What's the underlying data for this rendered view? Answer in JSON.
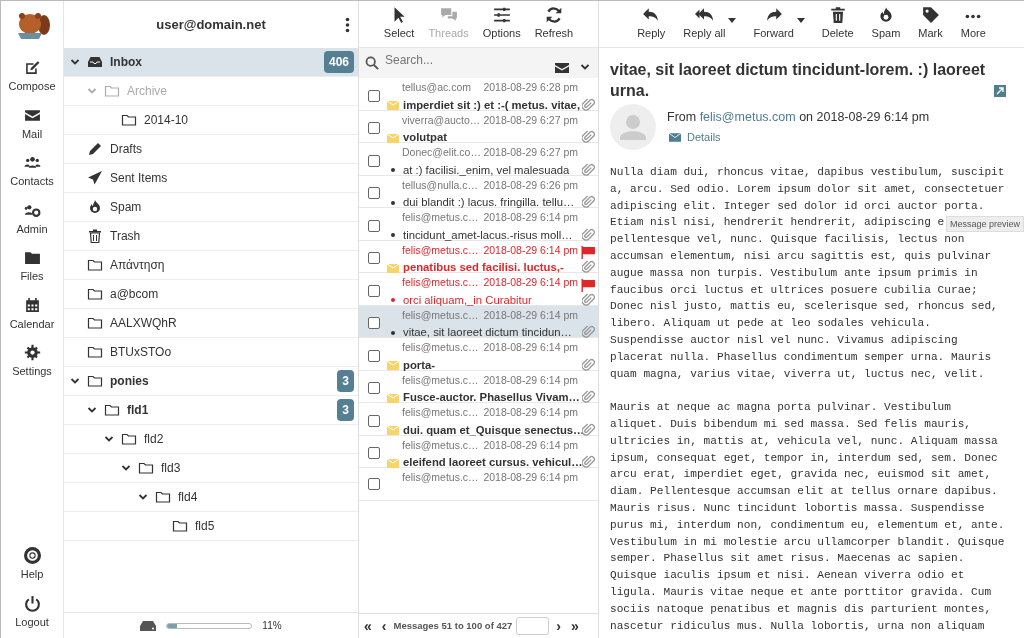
{
  "nav": {
    "items": [
      {
        "kind": "compose",
        "label": "Compose"
      },
      {
        "kind": "mail",
        "label": "Mail"
      },
      {
        "kind": "contacts",
        "label": "Contacts"
      },
      {
        "kind": "admin",
        "label": "Admin"
      },
      {
        "kind": "files",
        "label": "Files"
      },
      {
        "kind": "calendar",
        "label": "Calendar"
      },
      {
        "kind": "settings",
        "label": "Settings"
      }
    ],
    "bottom": [
      {
        "kind": "help",
        "label": "Help"
      },
      {
        "kind": "logout",
        "label": "Logout"
      }
    ]
  },
  "folders": {
    "account": "user@domain.net",
    "items": [
      {
        "kind": "inbox",
        "name": "Inbox",
        "count": "406",
        "selected": true,
        "bold": true,
        "expanded": true,
        "disabled": false,
        "children": [
          {
            "kind": "folder",
            "name": "Archive",
            "selected": false,
            "bold": false,
            "expanded": true,
            "disabled": true,
            "children": [
              {
                "kind": "folder",
                "name": "2014-10",
                "selected": false,
                "bold": false,
                "disabled": false
              }
            ]
          }
        ]
      },
      {
        "kind": "drafts",
        "name": "Drafts",
        "selected": false,
        "bold": false,
        "disabled": false
      },
      {
        "kind": "sent",
        "name": "Sent Items",
        "selected": false,
        "bold": false,
        "disabled": false
      },
      {
        "kind": "spam",
        "name": "Spam",
        "selected": false,
        "bold": false,
        "disabled": false
      },
      {
        "kind": "trash",
        "name": "Trash",
        "selected": false,
        "bold": false,
        "disabled": false
      },
      {
        "kind": "folder",
        "name": "Απάντηση",
        "selected": false,
        "bold": false,
        "disabled": false
      },
      {
        "kind": "folder",
        "name": "a@bcom",
        "selected": false,
        "bold": false,
        "disabled": false
      },
      {
        "kind": "folder",
        "name": "AALXWQhR",
        "selected": false,
        "bold": false,
        "disabled": false
      },
      {
        "kind": "folder",
        "name": "BTUxSTOo",
        "selected": false,
        "bold": false,
        "disabled": false
      },
      {
        "kind": "folder",
        "name": "ponies",
        "count": "3",
        "selected": false,
        "bold": true,
        "expanded": true,
        "disabled": false,
        "children": [
          {
            "kind": "folder",
            "name": "fld1",
            "count": "3",
            "selected": false,
            "bold": true,
            "expanded": true,
            "disabled": false,
            "children": [
              {
                "kind": "folder",
                "name": "fld2",
                "selected": false,
                "bold": false,
                "expanded": true,
                "disabled": false,
                "children": [
                  {
                    "kind": "folder",
                    "name": "fld3",
                    "selected": false,
                    "bold": false,
                    "expanded": true,
                    "disabled": false,
                    "children": [
                      {
                        "kind": "folder",
                        "name": "fld4",
                        "selected": false,
                        "bold": false,
                        "expanded": true,
                        "disabled": false,
                        "children": [
                          {
                            "kind": "folder",
                            "name": "fld5",
                            "selected": false,
                            "bold": false,
                            "disabled": false
                          }
                        ]
                      }
                    ]
                  }
                ]
              }
            ]
          }
        ]
      }
    ],
    "quota": {
      "level": 0.11,
      "text": "11%"
    }
  },
  "list_toolbar": [
    {
      "kind": "select",
      "label": "Select",
      "disabled": false
    },
    {
      "kind": "threads",
      "label": "Threads",
      "disabled": true
    },
    {
      "kind": "options",
      "label": "Options",
      "disabled": false
    },
    {
      "kind": "refresh",
      "label": "Refresh",
      "disabled": false
    }
  ],
  "search": {
    "placeholder": "Search..."
  },
  "messages": [
    {
      "sender": "tellus@ac.com",
      "date": "2018-08-29 6:28 pm",
      "subject": "imperdiet sit :) et :-( metus. vitae,",
      "unread": true,
      "flagged": false,
      "selected": false,
      "attachment": true
    },
    {
      "sender": "viverra@aucto…",
      "date": "2018-08-29 6:27 pm",
      "subject": "volutpat",
      "unread": true,
      "flagged": false,
      "selected": false,
      "attachment": true
    },
    {
      "sender": "Donec@elit.co…",
      "date": "2018-08-29 6:27 pm",
      "subject": "at :) facilisi._enim, vel malesuada",
      "unread": false,
      "flagged": false,
      "selected": false,
      "attachment": true
    },
    {
      "sender": "tellus@nulla.c…",
      "date": "2018-08-29 6:26 pm",
      "subject": "dui blandit :) lacus. fringilla. tellu…",
      "unread": false,
      "flagged": false,
      "selected": false,
      "attachment": true
    },
    {
      "sender": "felis@metus.c…",
      "date": "2018-08-29 6:14 pm",
      "subject": "tincidunt_amet-lacus.-risus moll…",
      "unread": false,
      "flagged": false,
      "selected": false,
      "attachment": true
    },
    {
      "sender": "felis@metus.c…",
      "date": "2018-08-29 6:14 pm",
      "subject": "penatibus sed facilisi. luctus,-",
      "unread": true,
      "flagged": true,
      "selected": false,
      "attachment": true
    },
    {
      "sender": "felis@metus.c…",
      "date": "2018-08-29 6:14 pm",
      "subject": "orci aliquam,_in Curabitur",
      "unread": false,
      "flagged": true,
      "selected": false,
      "attachment": true
    },
    {
      "sender": "felis@metus.c…",
      "date": "2018-08-29 6:14 pm",
      "subject": "vitae, sit laoreet dictum tincidun…",
      "unread": false,
      "flagged": false,
      "selected": true,
      "attachment": true
    },
    {
      "sender": "felis@metus.c…",
      "date": "2018-08-29 6:14 pm",
      "subject": "porta-",
      "unread": true,
      "flagged": false,
      "selected": false,
      "attachment": true
    },
    {
      "sender": "felis@metus.c…",
      "date": "2018-08-29 6:14 pm",
      "subject": "Fusce-auctor. Phasellus Vivam…",
      "unread": true,
      "flagged": false,
      "selected": false,
      "attachment": true
    },
    {
      "sender": "felis@metus.c…",
      "date": "2018-08-29 6:14 pm",
      "subject": "dui. quam et_Quisque senectus…",
      "unread": true,
      "flagged": false,
      "selected": false,
      "attachment": true
    },
    {
      "sender": "felis@metus.c…",
      "date": "2018-08-29 6:14 pm",
      "subject": "eleifend laoreet cursus. vehicul…",
      "unread": true,
      "flagged": false,
      "selected": false,
      "attachment": true
    },
    {
      "sender": "felis@metus.c…",
      "date": "2018-08-29 6:14 pm",
      "selected": false
    }
  ],
  "pager": {
    "first": "«",
    "prev": "‹",
    "text": "Messages 51 to 100 of 427",
    "next": "›",
    "last": "»"
  },
  "reader_toolbar": [
    {
      "kind": "reply",
      "label": "Reply",
      "dropdown": false
    },
    {
      "kind": "replyall",
      "label": "Reply all",
      "dropdown": true
    },
    {
      "kind": "forward",
      "label": "Forward",
      "dropdown": true
    },
    {
      "kind": "delete",
      "label": "Delete",
      "dropdown": false
    },
    {
      "kind": "spam",
      "label": "Spam",
      "dropdown": false
    },
    {
      "kind": "mark",
      "label": "Mark",
      "dropdown": false
    },
    {
      "kind": "more",
      "label": "More",
      "dropdown": false
    }
  ],
  "message": {
    "subject": "vitae, sit laoreet dictum tincidunt-lorem. :) laoreet urna.",
    "from_label": "From",
    "from": "felis@metus.com",
    "date_label": "on 2018-08-29 6:14 pm",
    "details": "Details",
    "body": [
      [
        "Nulla diam dui, rhoncus vitae, dapibus vestibulum, suscipit",
        "a, arcu. Sed odio. Lorem ipsum dolor sit amet, consectetuer",
        "adipiscing elit. Integer sed dolor id orci auctor porta.",
        "Etiam nisl nisi, hendrerit hendrerit, adipiscing e",
        "pellentesque vel, nunc. Quisque facilisis, lectus non",
        "accumsan elementum, nisi arcu sagittis est, quis pulvinar",
        "augue massa non turpis. Vestibulum ante ipsum primis in",
        "faucibus orci luctus et ultrices posuere cubilia Curae;",
        "Donec nisl justo, mattis eu, scelerisque sed, rhoncus sed,",
        "libero. Aliquam ut pede at leo sodales vehicula.",
        "Suspendisse auctor nisl vel nunc. Vivamus adipiscing",
        "placerat nulla. Phasellus condimentum semper urna. Mauris",
        "quam magna, varius vitae, viverra ut, luctus nec, velit."
      ],
      [
        "Mauris at neque ac magna porta pulvinar. Vestibulum",
        "aliquet. Duis bibendum mi sed massa. Sed felis mauris,",
        "ultricies in, mattis at, vehicula vel, nunc. Aliquam massa",
        "ipsum, consequat eget, tempor in, interdum sed, sem. Donec",
        "arcu erat, imperdiet eget, gravida nec, euismod sit amet,",
        "diam. Pellentesque accumsan elit at tellus ornare dapibus.",
        "Mauris risus. Nunc tincidunt lobortis massa. Suspendisse",
        "purus mi, interdum non, condimentum eu, elementum et, ante.",
        "Vestibulum in mi molestie arcu ullamcorper blandit. Quisque",
        "semper. Phasellus sit amet risus. Maecenas ac sapien.",
        "Quisque iaculis ipsum et nisi. Aenean viverra odio et",
        "ligula. Mauris vitae neque et ante porttitor gravida. Cum",
        "sociis natoque penatibus et magnis dis parturient montes,",
        "nascetur ridiculus mus. Nulla lobortis, urna non aliquam"
      ]
    ]
  },
  "tooltip": "Message preview"
}
